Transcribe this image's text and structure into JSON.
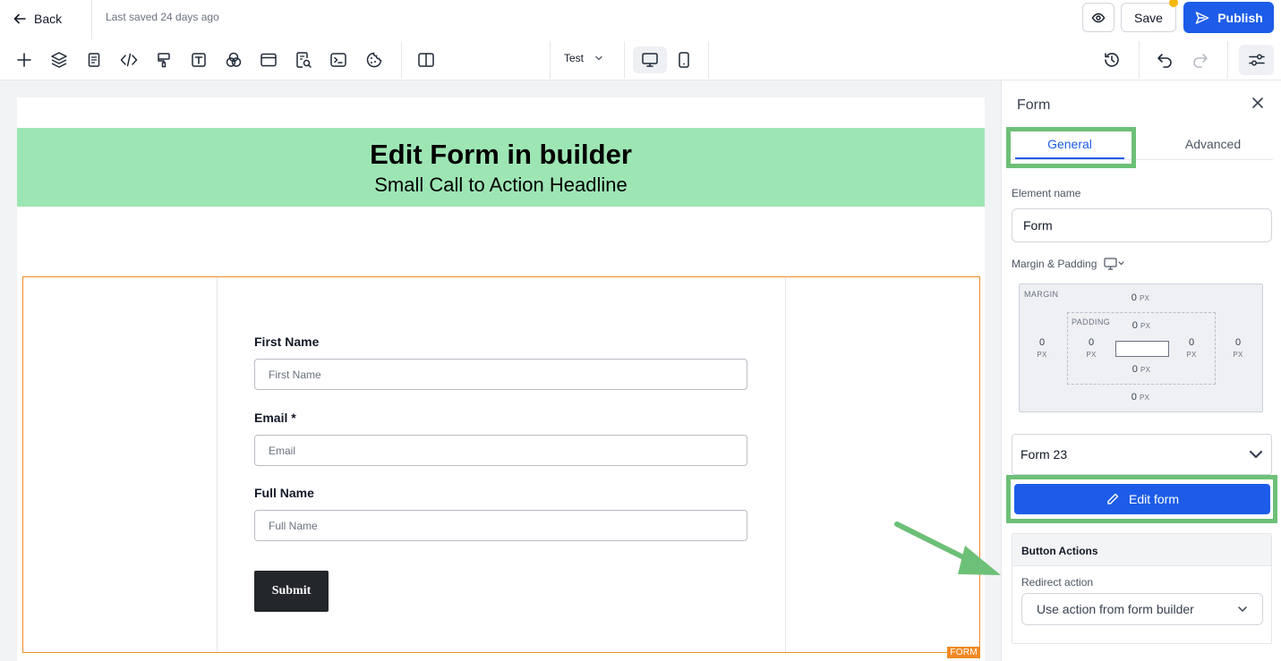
{
  "topbar": {
    "back_label": "Back",
    "saved_status": "Last saved 24 days ago",
    "save_label": "Save",
    "publish_label": "Publish"
  },
  "toolbar": {
    "icons": [
      "plus-icon",
      "layers-icon",
      "page-icon",
      "code-icon",
      "paint-roller-icon",
      "text-icon",
      "circles-icon",
      "browser-window-icon",
      "search-doc-icon",
      "terminal-icon",
      "cookie-icon",
      "split-view-icon"
    ],
    "test_select": "Test"
  },
  "canvas": {
    "hero_title": "Edit Form in builder",
    "hero_subtitle": "Small Call to Action Headline",
    "form_tag": "FORM",
    "fields": [
      {
        "label": "First Name",
        "placeholder": "First Name"
      },
      {
        "label": "Email *",
        "placeholder": "Email"
      },
      {
        "label": "Full Name",
        "placeholder": "Full Name"
      }
    ],
    "submit_label": "Submit"
  },
  "panel": {
    "title": "Form",
    "tabs": {
      "general": "General",
      "advanced": "Advanced"
    },
    "element_name_label": "Element name",
    "element_name_value": "Form",
    "margin_padding_label": "Margin & Padding",
    "box": {
      "margin_caption": "MARGIN",
      "padding_caption": "PADDING",
      "margin_top": "0",
      "margin_bottom": "0",
      "margin_left": "0",
      "margin_right": "0",
      "padding_top": "0",
      "padding_bottom": "0",
      "padding_left": "0",
      "padding_right": "0",
      "unit": "PX"
    },
    "form_select_value": "Form 23",
    "edit_form_label": "Edit form",
    "button_actions_title": "Button Actions",
    "redirect_label": "Redirect action",
    "redirect_value": "Use action from form builder"
  },
  "colors": {
    "accent": "#1d5ce8",
    "hero_bg": "#9de6b4",
    "highlight_green": "#6dc077",
    "form_outline": "#f08a24",
    "save_dot": "#f5b70a"
  }
}
